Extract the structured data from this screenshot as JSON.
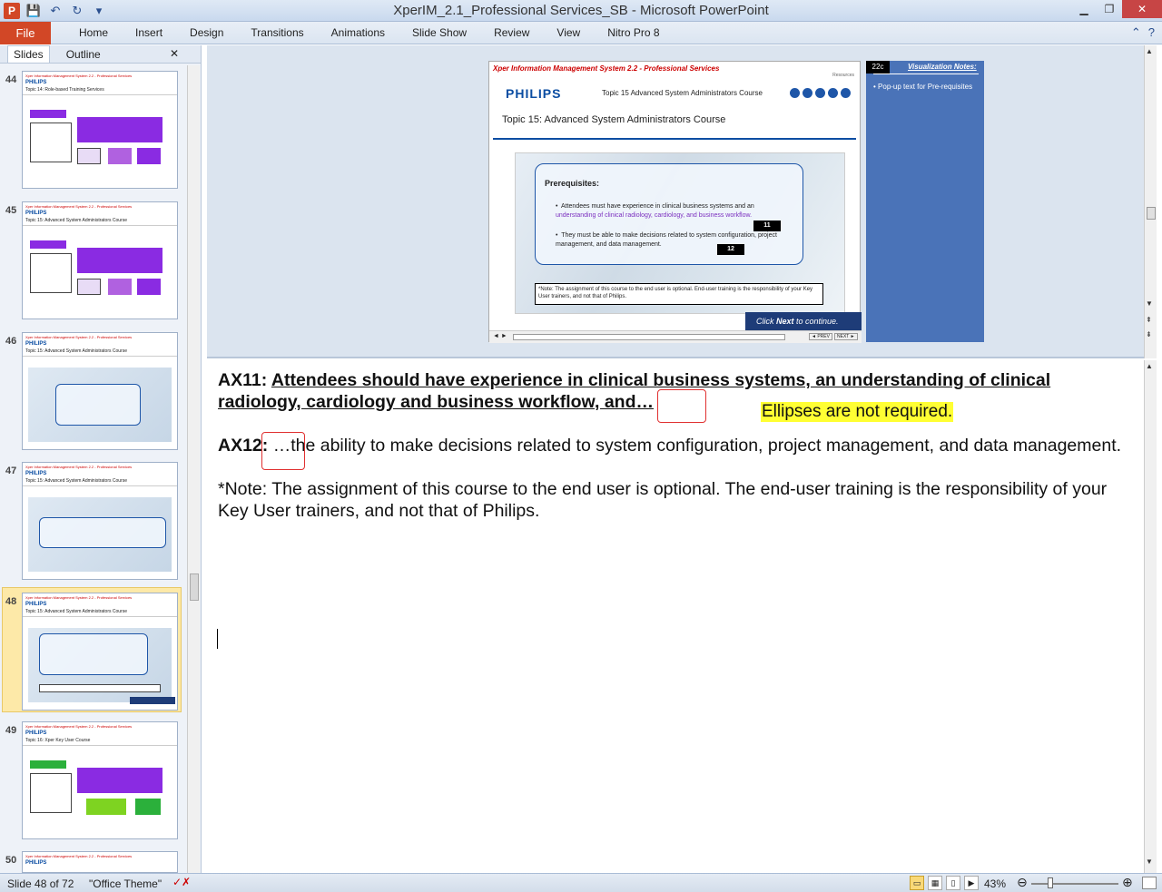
{
  "window": {
    "title": "XperIM_2.1_Professional Services_SB - Microsoft PowerPoint",
    "app_icon_letter": "P"
  },
  "ribbon": {
    "file": "File",
    "tabs": [
      "Home",
      "Insert",
      "Design",
      "Transitions",
      "Animations",
      "Slide Show",
      "Review",
      "View",
      "Nitro Pro 8"
    ]
  },
  "pane": {
    "tab_slides": "Slides",
    "tab_outline": "Outline",
    "close": "✕"
  },
  "thumbnails": [
    {
      "num": "44",
      "topic": "Topic 14: Role-based Training Services",
      "kind": "overview-purple"
    },
    {
      "num": "45",
      "topic": "Topic 15: Advanced System Administrators Course",
      "kind": "overview-purple"
    },
    {
      "num": "46",
      "topic": "Topic 15: Advanced System Administrators Course",
      "kind": "photo-offered"
    },
    {
      "num": "47",
      "topic": "Topic 15: Advanced System Administrators Course",
      "kind": "photo-who"
    },
    {
      "num": "48",
      "topic": "Topic 15: Advanced System Administrators Course",
      "kind": "photo-prereq"
    },
    {
      "num": "49",
      "topic": "Topic 16: Xper Key User Course",
      "kind": "overview-green"
    },
    {
      "num": "50",
      "topic": "",
      "kind": "partial"
    }
  ],
  "slide": {
    "header": "Xper Information Management System 2.2 - Professional Services",
    "resources": "Resources",
    "brand": "PHILIPS",
    "course": "Topic 15 Advanced System Administrators Course",
    "topic": "Topic 15: Advanced System Administrators Course",
    "prereq_title": "Prerequisites:",
    "bullet1_a": "Attendees must have experience in clinical business systems and an",
    "bullet1_b": "understanding of clinical radiology, cardiology, and business workflow.",
    "bullet2": "They must be able to make decisions related to system configuration, project management,  and data management.",
    "badge11": "11",
    "badge12": "12",
    "note": "*Note:  The assignment of this course to the end user is optional. End-user training is the responsibility of your Key User trainers, and not that of Philips.",
    "next_prefix": "Click ",
    "next_word": "Next",
    "next_suffix": " to continue.",
    "prev_btn": "◄ PREV",
    "next_btn": "NEXT ►"
  },
  "visnotes": {
    "id": "22c",
    "title": "Visualization Notes:",
    "text": "Pop-up text for Pre-requisites"
  },
  "notes": {
    "ax11_label": "AX11: ",
    "ax11_text": "Attendees should have experience in clinical business systems, an understanding of clinical radiology, cardiology and business workflow, and…",
    "ax12_label": "AX12: ",
    "ax12_text": "…the ability to make decisions related to system configuration, project management, and data management.",
    "note_text": "*Note: The assignment of this course to the end user is optional. The end-user training is the responsibility of your Key User trainers, and not that of Philips.",
    "callout": "Ellipses are not required."
  },
  "status": {
    "slide_info": "Slide 48 of 72",
    "theme": "\"Office Theme\"",
    "zoom": "43%"
  }
}
